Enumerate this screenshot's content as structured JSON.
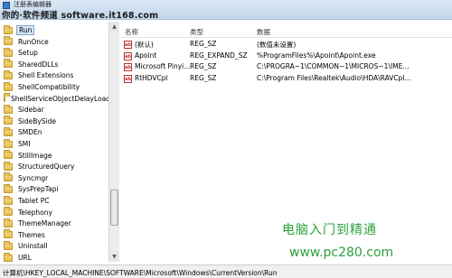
{
  "window": {
    "title": "注册表编辑器",
    "watermark": "你的·软件频道 software.it168.com"
  },
  "tree": {
    "items": [
      {
        "label": "Run",
        "selected": true
      },
      {
        "label": "RunOnce"
      },
      {
        "label": "Setup"
      },
      {
        "label": "SharedDLLs"
      },
      {
        "label": "Shell Extensions"
      },
      {
        "label": "ShellCompatibility"
      },
      {
        "label": "ShellServiceObjectDelayLoad"
      },
      {
        "label": "Sidebar"
      },
      {
        "label": "SideBySide"
      },
      {
        "label": "SMDEn"
      },
      {
        "label": "SMI"
      },
      {
        "label": "StillImage"
      },
      {
        "label": "StructuredQuery"
      },
      {
        "label": "Syncmgr"
      },
      {
        "label": "SysPrepTapi"
      },
      {
        "label": "Tablet PC"
      },
      {
        "label": "Telephony"
      },
      {
        "label": "ThemeManager"
      },
      {
        "label": "Themes"
      },
      {
        "label": "Uninstall"
      },
      {
        "label": "URL"
      }
    ]
  },
  "list": {
    "headers": [
      "名称",
      "类型",
      "数据"
    ],
    "rows": [
      {
        "name": "(默认)",
        "type": "REG_SZ",
        "data": "(数值未设置)"
      },
      {
        "name": "Apoint",
        "type": "REG_EXPAND_SZ",
        "data": "%ProgramFiles%\\Apoint\\Apoint.exe"
      },
      {
        "name": "Microsoft Pinyi...",
        "type": "REG_SZ",
        "data": "C:\\PROGRA~1\\COMMON~1\\MICROS~1\\IME..."
      },
      {
        "name": "RtHDVCpl",
        "type": "REG_SZ",
        "data": "C:\\Program Files\\Realtek\\Audio\\HDA\\RAVCpl..."
      }
    ]
  },
  "branding": {
    "name": "电脑入门到精通",
    "url": "www.pc280.com"
  },
  "statusbar": {
    "path": "计算机\\HKEY_LOCAL_MACHINE\\SOFTWARE\\Microsoft\\Windows\\CurrentVersion\\Run"
  }
}
